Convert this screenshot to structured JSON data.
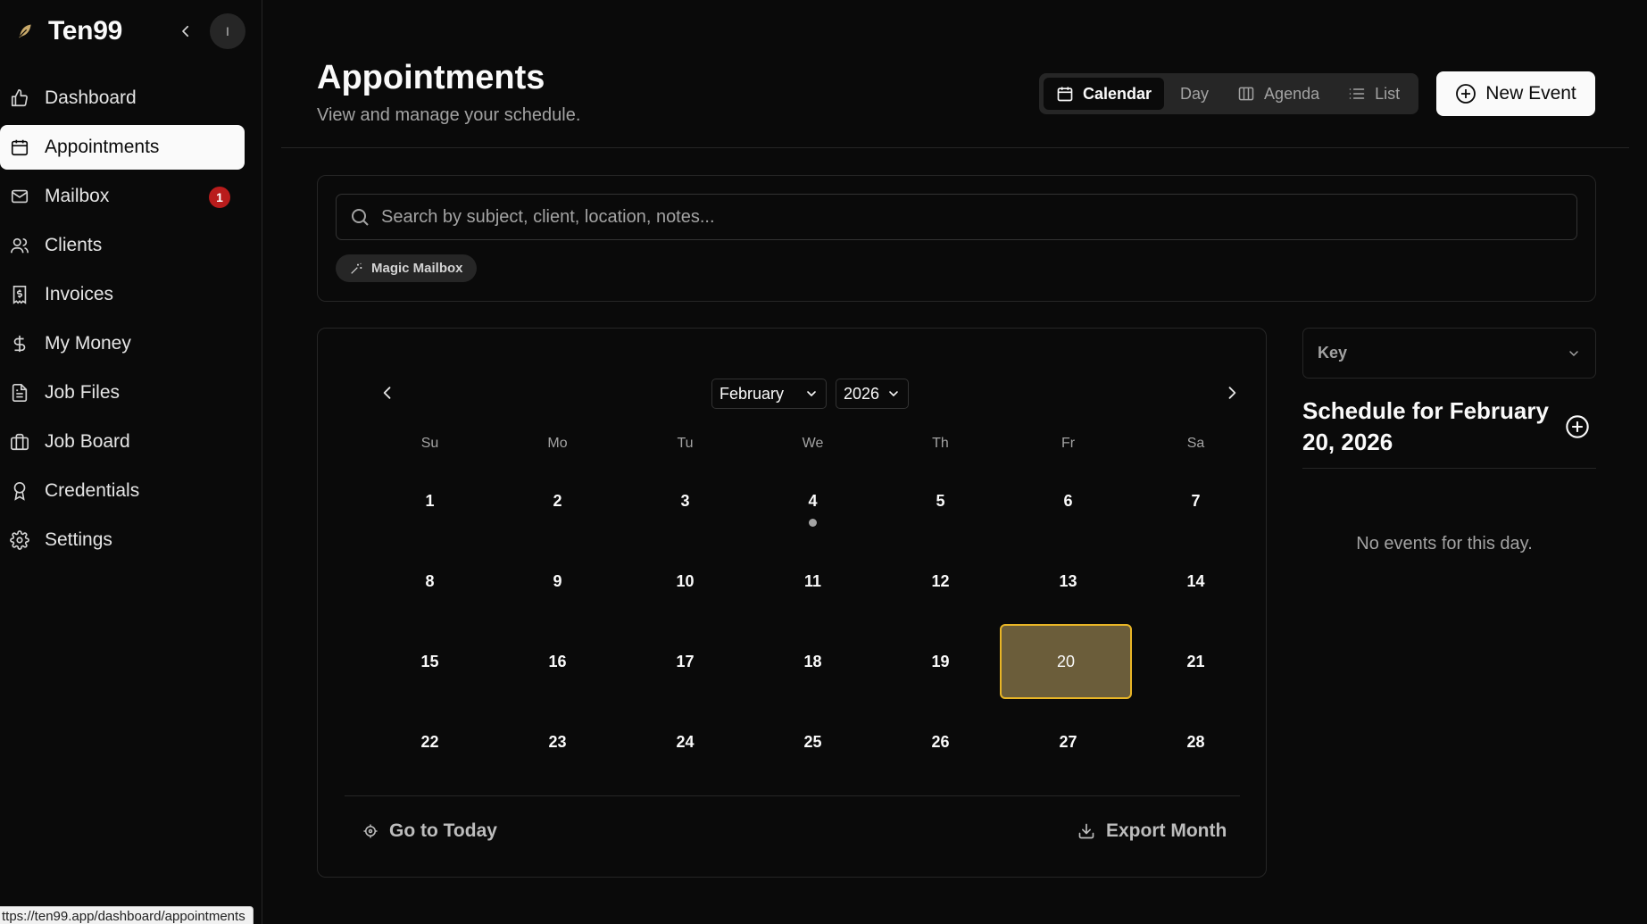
{
  "sidebar": {
    "brand": "Ten99",
    "avatar_initial": "I",
    "items": [
      {
        "label": "Dashboard",
        "icon": "thumbs-up-icon"
      },
      {
        "label": "Appointments",
        "icon": "calendar-icon",
        "active": true
      },
      {
        "label": "Mailbox",
        "icon": "mail-icon",
        "badge": "1"
      },
      {
        "label": "Clients",
        "icon": "users-icon"
      },
      {
        "label": "Invoices",
        "icon": "receipt-icon"
      },
      {
        "label": "My Money",
        "icon": "dollar-icon"
      },
      {
        "label": "Job Files",
        "icon": "file-text-icon"
      },
      {
        "label": "Job Board",
        "icon": "briefcase-icon"
      },
      {
        "label": "Credentials",
        "icon": "award-icon"
      },
      {
        "label": "Settings",
        "icon": "gear-icon"
      }
    ]
  },
  "header": {
    "title": "Appointments",
    "subtitle": "View and manage your schedule.",
    "tabs": [
      {
        "label": "Calendar",
        "icon": "calendar-icon",
        "active": true
      },
      {
        "label": "Day",
        "icon": ""
      },
      {
        "label": "Agenda",
        "icon": "columns-icon"
      },
      {
        "label": "List",
        "icon": "list-icon"
      }
    ],
    "new_event_label": "New Event"
  },
  "search": {
    "placeholder": "Search by subject, client, location, notes...",
    "value": "",
    "chip_label": "Magic Mailbox"
  },
  "calendar": {
    "month": "February",
    "year": "2026",
    "weekdays": [
      "Su",
      "Mo",
      "Tu",
      "We",
      "Th",
      "Fr",
      "Sa"
    ],
    "weeks": [
      [
        "1",
        "2",
        "3",
        "4",
        "5",
        "6",
        "7"
      ],
      [
        "8",
        "9",
        "10",
        "11",
        "12",
        "13",
        "14"
      ],
      [
        "15",
        "16",
        "17",
        "18",
        "19",
        "20",
        "21"
      ],
      [
        "22",
        "23",
        "24",
        "25",
        "26",
        "27",
        "28"
      ]
    ],
    "selected_day": "20",
    "days_with_events": [
      "4"
    ],
    "go_today_label": "Go to Today",
    "export_label": "Export Month"
  },
  "schedule": {
    "key_label": "Key",
    "title": "Schedule for February 20, 2026",
    "empty_text": "No events for this day."
  },
  "status_url": "ttps://ten99.app/dashboard/appointments",
  "colors": {
    "background": "#0a0a0a",
    "selected_day_fill": "#6b5d3a",
    "selected_day_border": "#e8b526",
    "badge": "#b91c1c"
  }
}
